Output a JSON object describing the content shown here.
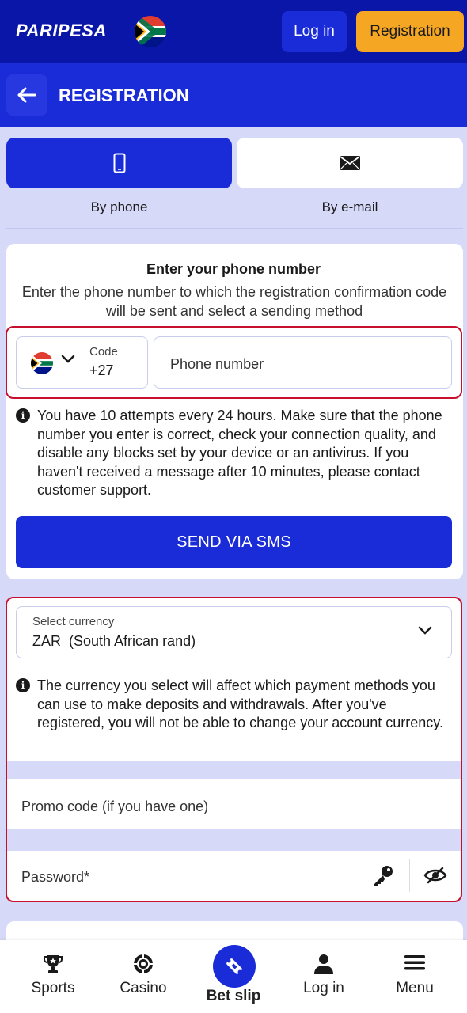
{
  "header": {
    "logo_text": "PARIPESA",
    "login_label": "Log in",
    "registration_label": "Registration",
    "colors": {
      "header_bg": "#0a16a8",
      "accent": "#1a2bd8",
      "registration_bg": "#f5a623"
    }
  },
  "title_bar": {
    "title": "REGISTRATION",
    "back_icon": "arrow-left-icon"
  },
  "tabs": [
    {
      "label": "By phone",
      "icon": "mobile-phone-icon",
      "active": true
    },
    {
      "label": "By e-mail",
      "icon": "envelope-icon",
      "active": false
    }
  ],
  "phone_section": {
    "heading": "Enter your phone number",
    "description": "Enter the phone number to which the registration confirmation code will be sent and select a sending method",
    "code_label": "Code",
    "code_value": "+27",
    "phone_placeholder": "Phone number",
    "attempts_note": "You have 10 attempts every 24 hours. Make sure that the phone number you enter is correct, check your connection quality, and disable any blocks set by your device or an antivirus. If you haven't received a message after 10 minutes, please contact customer support.",
    "send_button": "SEND VIA SMS"
  },
  "currency_section": {
    "label": "Select currency",
    "value": "ZAR  (South African rand)",
    "note": "The currency you select will affect which payment methods you can use to make deposits and withdrawals. After you've registered, you will not be able to change your account currency."
  },
  "promo": {
    "placeholder": "Promo code (if you have one)"
  },
  "password": {
    "placeholder": "Password*",
    "icons": [
      "key-icon",
      "eye-slash-icon"
    ]
  },
  "bottom_nav": [
    {
      "label": "Sports",
      "icon": "trophy-icon"
    },
    {
      "label": "Casino",
      "icon": "casino-chip-icon"
    },
    {
      "label": "Bet slip",
      "icon": "ticket-icon"
    },
    {
      "label": "Log in",
      "icon": "user-icon"
    },
    {
      "label": "Menu",
      "icon": "hamburger-icon"
    }
  ]
}
